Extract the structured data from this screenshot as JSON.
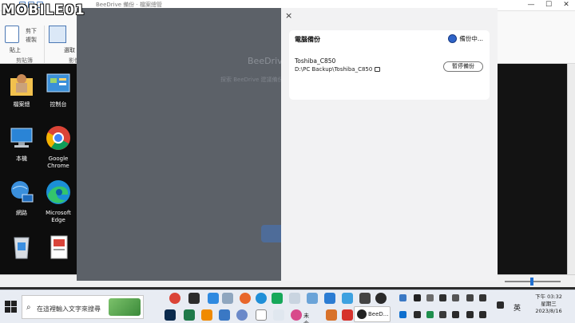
{
  "logo": {
    "text": "MOBILE01"
  },
  "window": {
    "title": "BeeDrive 備份 · 檔案總管",
    "controls": {
      "minimize": "—",
      "maximize": "☐",
      "close": "✕"
    }
  },
  "ribbon": {
    "paste_label": "貼上",
    "cut_label": "剪下",
    "copy_label": "複製",
    "clipboard_group": "剪貼簿",
    "select_label": "選取",
    "image_group": "影像"
  },
  "desktop": {
    "icons": [
      {
        "label": "檔案總",
        "icon": "user-folder-icon"
      },
      {
        "label": "控制台",
        "icon": "control-panel-icon"
      },
      {
        "label": "本機",
        "icon": "computer-icon"
      },
      {
        "label": "Google Chrome",
        "icon": "chrome-icon"
      },
      {
        "label": "網路",
        "icon": "network-icon"
      },
      {
        "label": "Microsoft Edge",
        "icon": "edge-icon"
      }
    ]
  },
  "overlay": {
    "ghost_title": "BeeDrive",
    "ghost_subtitle": "探索 BeeDrive 建議備份"
  },
  "panel": {
    "close_symbol": "×",
    "card": {
      "title": "電腦備份",
      "status": "備份中...",
      "device_name": "Toshiba_C850",
      "device_path": "D:\\PC Backup\\Toshiba_C850",
      "pause_button": "暫停備份"
    }
  },
  "taskbar": {
    "search_placeholder": "在這裡輸入文字來搜尋",
    "search_icon": "⌕",
    "open_app_label_1": "未命...",
    "open_app_label_2": "BeeD...",
    "ime": "英",
    "time": "下午 03:32",
    "weekday": "星期三",
    "date": "2023/8/16"
  },
  "colors": {
    "overlay": "#5c6168",
    "panel_bg": "#f2f2f3",
    "status_icon": "#2f64c8",
    "taskbar": "#e8ecf3"
  }
}
